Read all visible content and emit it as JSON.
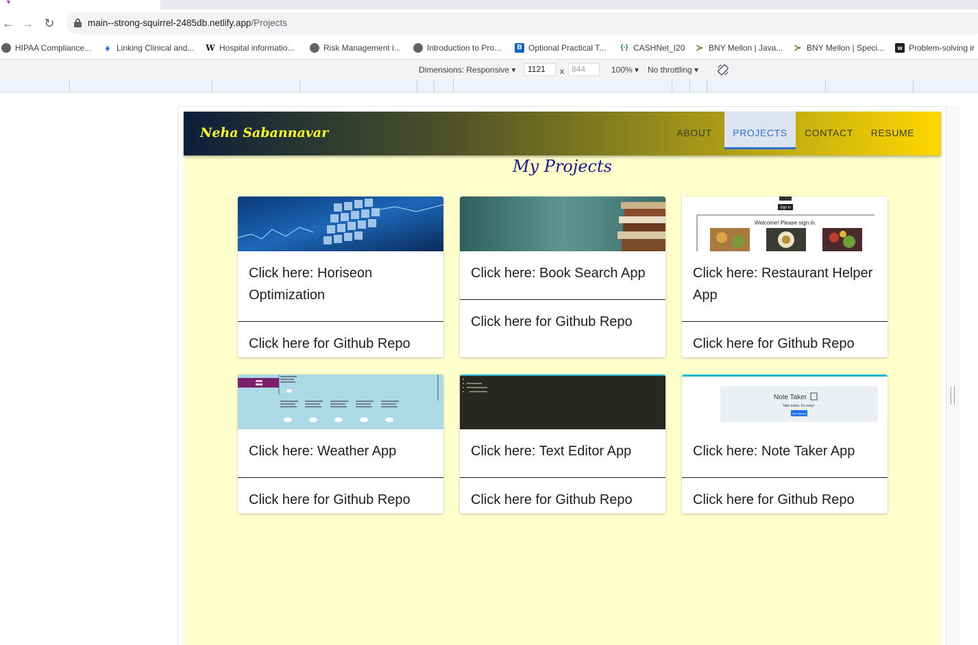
{
  "browser": {
    "url_host": "main--strong-squirrel-2485db.netlify.app",
    "url_path": "/Projects",
    "bookmarks": [
      {
        "label": "HIPAA Compliance...",
        "icon": "globe-icon"
      },
      {
        "label": "Linking Clinical and...",
        "icon": "flame-icon"
      },
      {
        "label": "Hospital informatio...",
        "icon": "wikipedia-icon"
      },
      {
        "label": "Risk Management i...",
        "icon": "globe-icon"
      },
      {
        "label": "Introduction to Pro...",
        "icon": "globe-icon"
      },
      {
        "label": "Optional Practical T...",
        "icon": "b-icon"
      },
      {
        "label": "CASHNet_I20",
        "icon": "bracket-icon"
      },
      {
        "label": "BNY Mellon | Java...",
        "icon": "forage-icon"
      },
      {
        "label": "BNY Mellon | Speci...",
        "icon": "forage-icon"
      },
      {
        "label": "Problem-solving ir",
        "icon": "w-icon"
      }
    ]
  },
  "devtools": {
    "dimensions_label": "Dimensions: Responsive",
    "width": "1121",
    "x_label": "x",
    "height": "844",
    "zoom": "100%",
    "throttling": "No throttling"
  },
  "site": {
    "brand": "Neha Sabannavar",
    "nav": [
      "ABOUT",
      "PROJECTS",
      "CONTACT",
      "RESUME"
    ],
    "active_nav": "PROJECTS",
    "page_title": "My Projects",
    "repo_label": "Click here for Github Repo",
    "projects": [
      {
        "title": "Click here: Horiseon Optimization",
        "thumb": "code-cubes"
      },
      {
        "title": "Click here: Book Search App",
        "thumb": "books"
      },
      {
        "title": "Click here: Restaurant Helper App",
        "thumb": "restaurant"
      },
      {
        "title": "Click here: Weather App",
        "thumb": "weather"
      },
      {
        "title": "Click here: Text Editor App",
        "thumb": "text-editor"
      },
      {
        "title": "Click here: Note Taker App",
        "thumb": "note-taker"
      }
    ],
    "thumb_text": {
      "restaurant_signin": "Sign In",
      "restaurant_welcome": "Welcome! Please sign in.",
      "note_title": "Note Taker",
      "note_sub": "Take notes. It's easy!",
      "note_button": "Get Started"
    }
  },
  "colors": {
    "accent": "#2d6fd1",
    "page_bg": "#ffffcc",
    "brand_text": "#ffff33",
    "title_text": "#1a1a8c"
  }
}
